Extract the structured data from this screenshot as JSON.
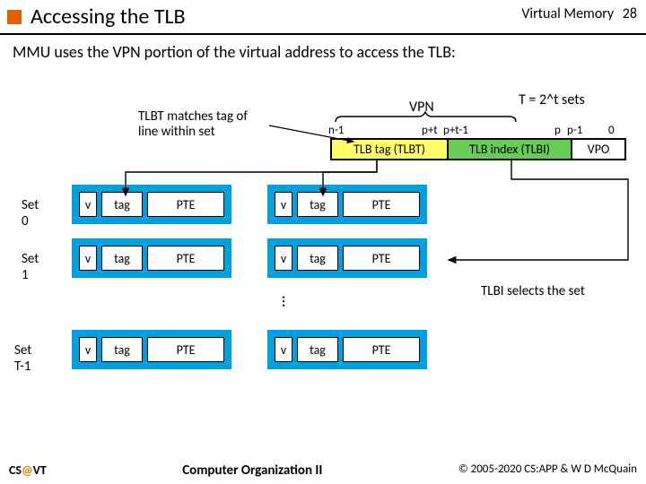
{
  "header": {
    "title": "Accessing the TLB",
    "section": "Virtual Memory",
    "page": "28"
  },
  "subtitle": "MMU uses the VPN portion of the virtual address to access the TLB:",
  "vpn": {
    "label": "VPN",
    "tsets": "T = 2^t sets",
    "bits": {
      "n1": "n-1",
      "pt": "p+t",
      "pt1": "p+t-1",
      "p": "p",
      "p1": "p-1",
      "zero": "0"
    },
    "cells": {
      "tlbt": "TLB tag (TLBT)",
      "tlbi": "TLB index (TLBI)",
      "vpo": "VPO"
    }
  },
  "note": {
    "l1": "TLBT matches tag of",
    "l2": "line within set"
  },
  "sets": {
    "labels": {
      "s0": "Set 0",
      "s1": "Set 1",
      "sT": "Set T-1"
    },
    "cols": {
      "v": "v",
      "tag": "tag",
      "pte": "PTE"
    }
  },
  "tlbi_note": "TLBI selects the set",
  "footer": {
    "left_cs": "CS",
    "left_at": "@",
    "left_vt": "VT",
    "mid": "Computer Organization II",
    "right": "© 2005-2020 CS:APP & W D McQuain"
  }
}
